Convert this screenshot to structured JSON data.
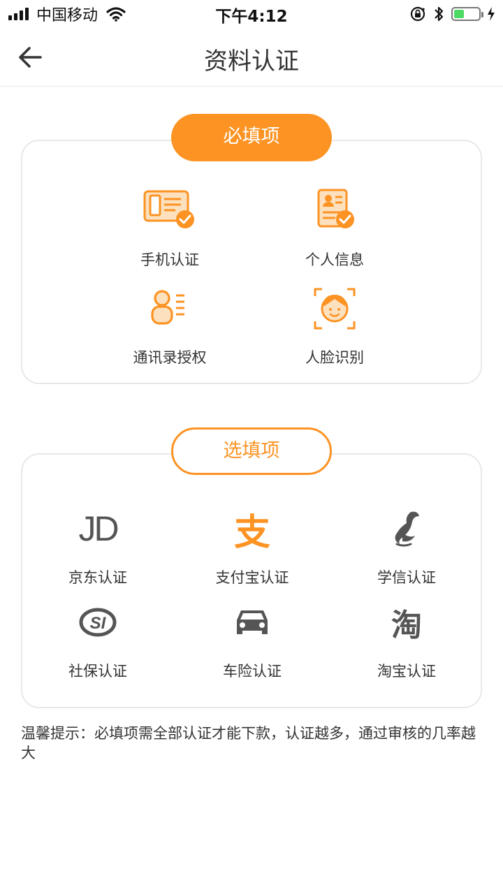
{
  "status_bar": {
    "carrier": "中国移动",
    "time": "下午4:12",
    "battery_level": 0.4
  },
  "nav": {
    "title": "资料认证",
    "back_icon": "arrow-left-icon"
  },
  "required_section": {
    "title": "必填项",
    "items": [
      {
        "label": "手机认证",
        "icon": "phone-id-card-check-icon"
      },
      {
        "label": "个人信息",
        "icon": "personal-info-document-check-icon"
      },
      {
        "label": "通讯录授权",
        "icon": "contacts-person-list-icon"
      },
      {
        "label": "人脸识别",
        "icon": "face-scan-icon"
      }
    ]
  },
  "optional_section": {
    "title": "选填项",
    "items": [
      {
        "label": "京东认证",
        "icon": "jd-logo-icon",
        "icon_text": "JD"
      },
      {
        "label": "支付宝认证",
        "icon": "alipay-logo-icon",
        "icon_text": "支"
      },
      {
        "label": "学信认证",
        "icon": "chsi-bird-logo-icon"
      },
      {
        "label": "社保认证",
        "icon": "social-security-logo-icon",
        "icon_text": "SI"
      },
      {
        "label": "车险认证",
        "icon": "car-icon"
      },
      {
        "label": "淘宝认证",
        "icon": "taobao-logo-icon",
        "icon_text": "淘"
      }
    ]
  },
  "tip": {
    "text": "温馨提示：必填项需全部认证才能下款，认证越多，通过审核的几率越大"
  },
  "colors": {
    "accent": "#fc9323",
    "icon_gray": "#555555",
    "border": "#e8e8e8"
  }
}
